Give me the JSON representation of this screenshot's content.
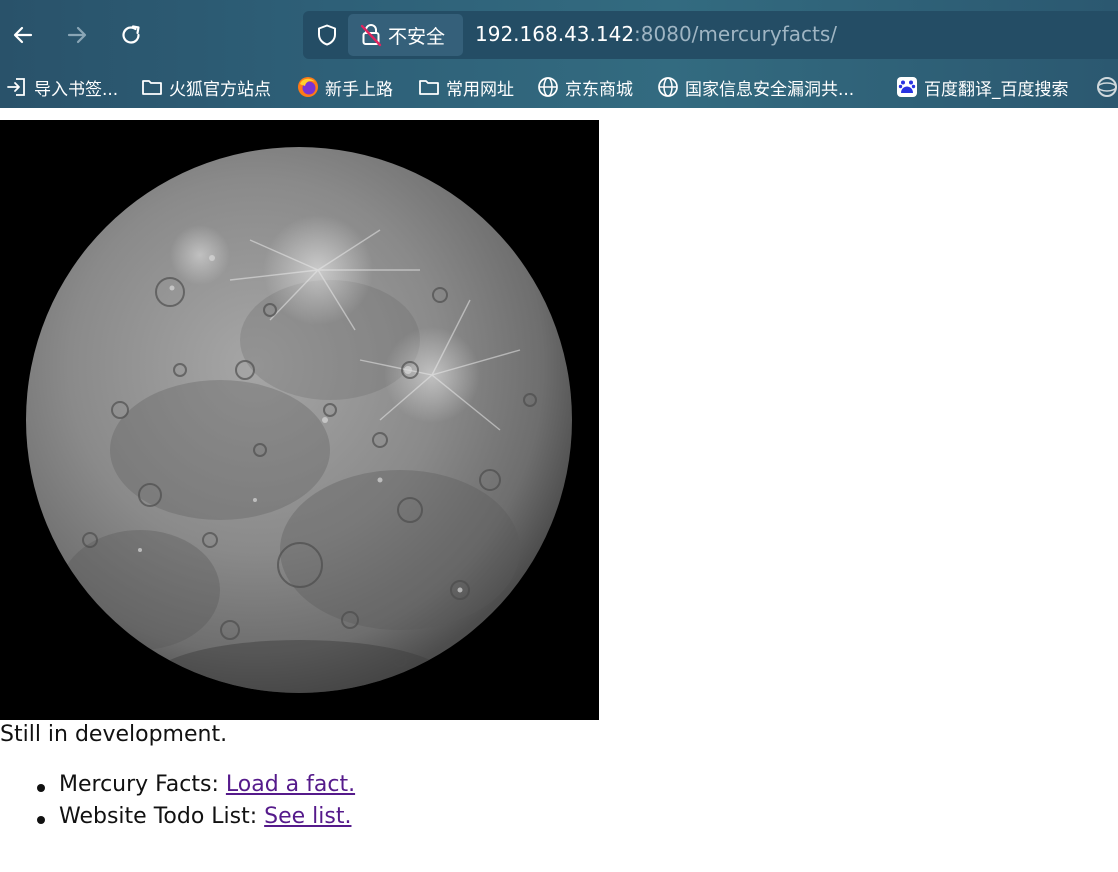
{
  "browser": {
    "security_label": "不安全",
    "url_host": "192.168.43.142",
    "url_rest": ":8080/mercuryfacts/",
    "bookmarks": [
      {
        "label": "导入书签...",
        "icon": "import-icon"
      },
      {
        "label": "火狐官方站点",
        "icon": "folder-icon"
      },
      {
        "label": "新手上路",
        "icon": "firefox-icon"
      },
      {
        "label": "常用网址",
        "icon": "folder-icon"
      },
      {
        "label": "京东商城",
        "icon": "globe-icon"
      },
      {
        "label": "国家信息安全漏洞共...",
        "icon": "globe-icon"
      },
      {
        "label": "百度翻译_百度搜索",
        "icon": "baidu-icon"
      }
    ]
  },
  "page": {
    "status": "Still in development.",
    "items": [
      {
        "label": "Mercury Facts: ",
        "link": "Load a fact."
      },
      {
        "label": "Website Todo List: ",
        "link": "See list."
      }
    ]
  },
  "colors": {
    "chrome": "#2e6078",
    "link_visited": "#551a8b"
  }
}
